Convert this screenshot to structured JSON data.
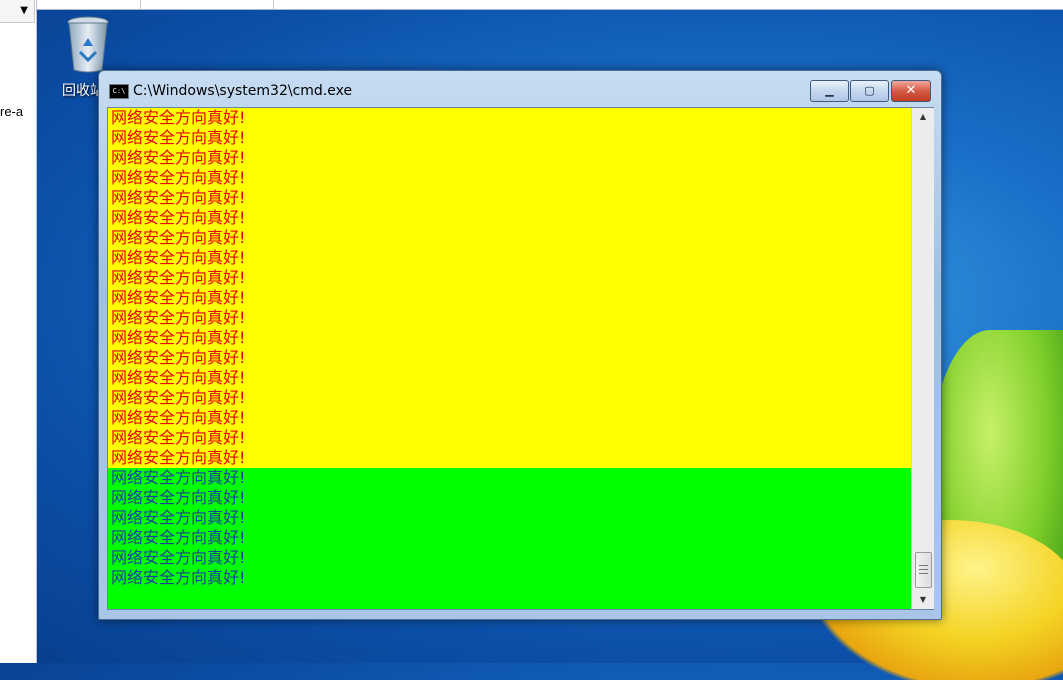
{
  "left_app": {
    "dropdown_arrow": "▼",
    "truncated_text": "re-a"
  },
  "desktop": {
    "recycle_bin_label": "回收站",
    "icon": "recycle-bin-icon"
  },
  "window": {
    "title": "C:\\Windows\\system32\\cmd.exe",
    "icon": "cmd-icon",
    "minimize_label": "▁",
    "maximize_label": "▢",
    "close_label": "✕",
    "colors": {
      "yellow_bg": "#ffff00",
      "green_bg": "#00ff00",
      "red_text": "#e8000a",
      "blue_text": "#1a3da0"
    }
  },
  "console": {
    "yellow_lines": [
      "网络安全方向真好!",
      "网络安全方向真好!",
      "网络安全方向真好!",
      "网络安全方向真好!",
      "网络安全方向真好!",
      "网络安全方向真好!",
      "网络安全方向真好!",
      "网络安全方向真好!",
      "网络安全方向真好!",
      "网络安全方向真好!",
      "网络安全方向真好!",
      "网络安全方向真好!",
      "网络安全方向真好!",
      "网络安全方向真好!",
      "网络安全方向真好!",
      "网络安全方向真好!",
      "网络安全方向真好!",
      "网络安全方向真好!"
    ],
    "green_lines": [
      "网络安全方向真好!",
      "网络安全方向真好!",
      "网络安全方向真好!",
      "网络安全方向真好!",
      "网络安全方向真好!",
      "网络安全方向真好!"
    ]
  },
  "scrollbar": {
    "up_arrow": "▲",
    "down_arrow": "▼"
  }
}
